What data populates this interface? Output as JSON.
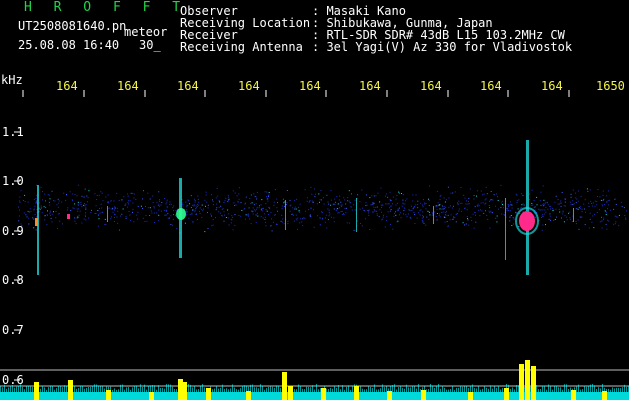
{
  "header": {
    "brand": "H R O F F T",
    "filename": "UT2508081640.pn",
    "mode_tag": "meteor",
    "datetime": "25.08.08 16:40",
    "interval": "30_",
    "info_rows": [
      {
        "label": "Observer",
        "value": ": Masaki Kano"
      },
      {
        "label": "Receiving Location",
        "value": ": Shibukawa, Gunma, Japan"
      },
      {
        "label": "Receiver",
        "value": ": RTL-SDR SDR# 43dB L15 103.2MHz CW"
      },
      {
        "label": "Receiving Antenna",
        "value": ": 3el Yagi(V) Az 330 for Vladivostok"
      }
    ]
  },
  "axes": {
    "y_unit": "kHz",
    "x_ticks": [
      "164",
      "164",
      "164",
      "164",
      "164",
      "164",
      "164",
      "164",
      "164",
      "1650"
    ],
    "y_ticks": [
      "1.1",
      "1.0",
      "0.9",
      "0.8",
      "0.7",
      "0.6"
    ]
  },
  "colors": {
    "background": "#000000",
    "brand_green": "#21d44a",
    "tick_yellow": "#f4f44a",
    "signal_low": "#1a2fc8",
    "signal_mid": "#20d4d4",
    "signal_high": "#ff2a8a",
    "level_yellow": "#ffff00",
    "level_cyan": "#00ffff"
  }
}
